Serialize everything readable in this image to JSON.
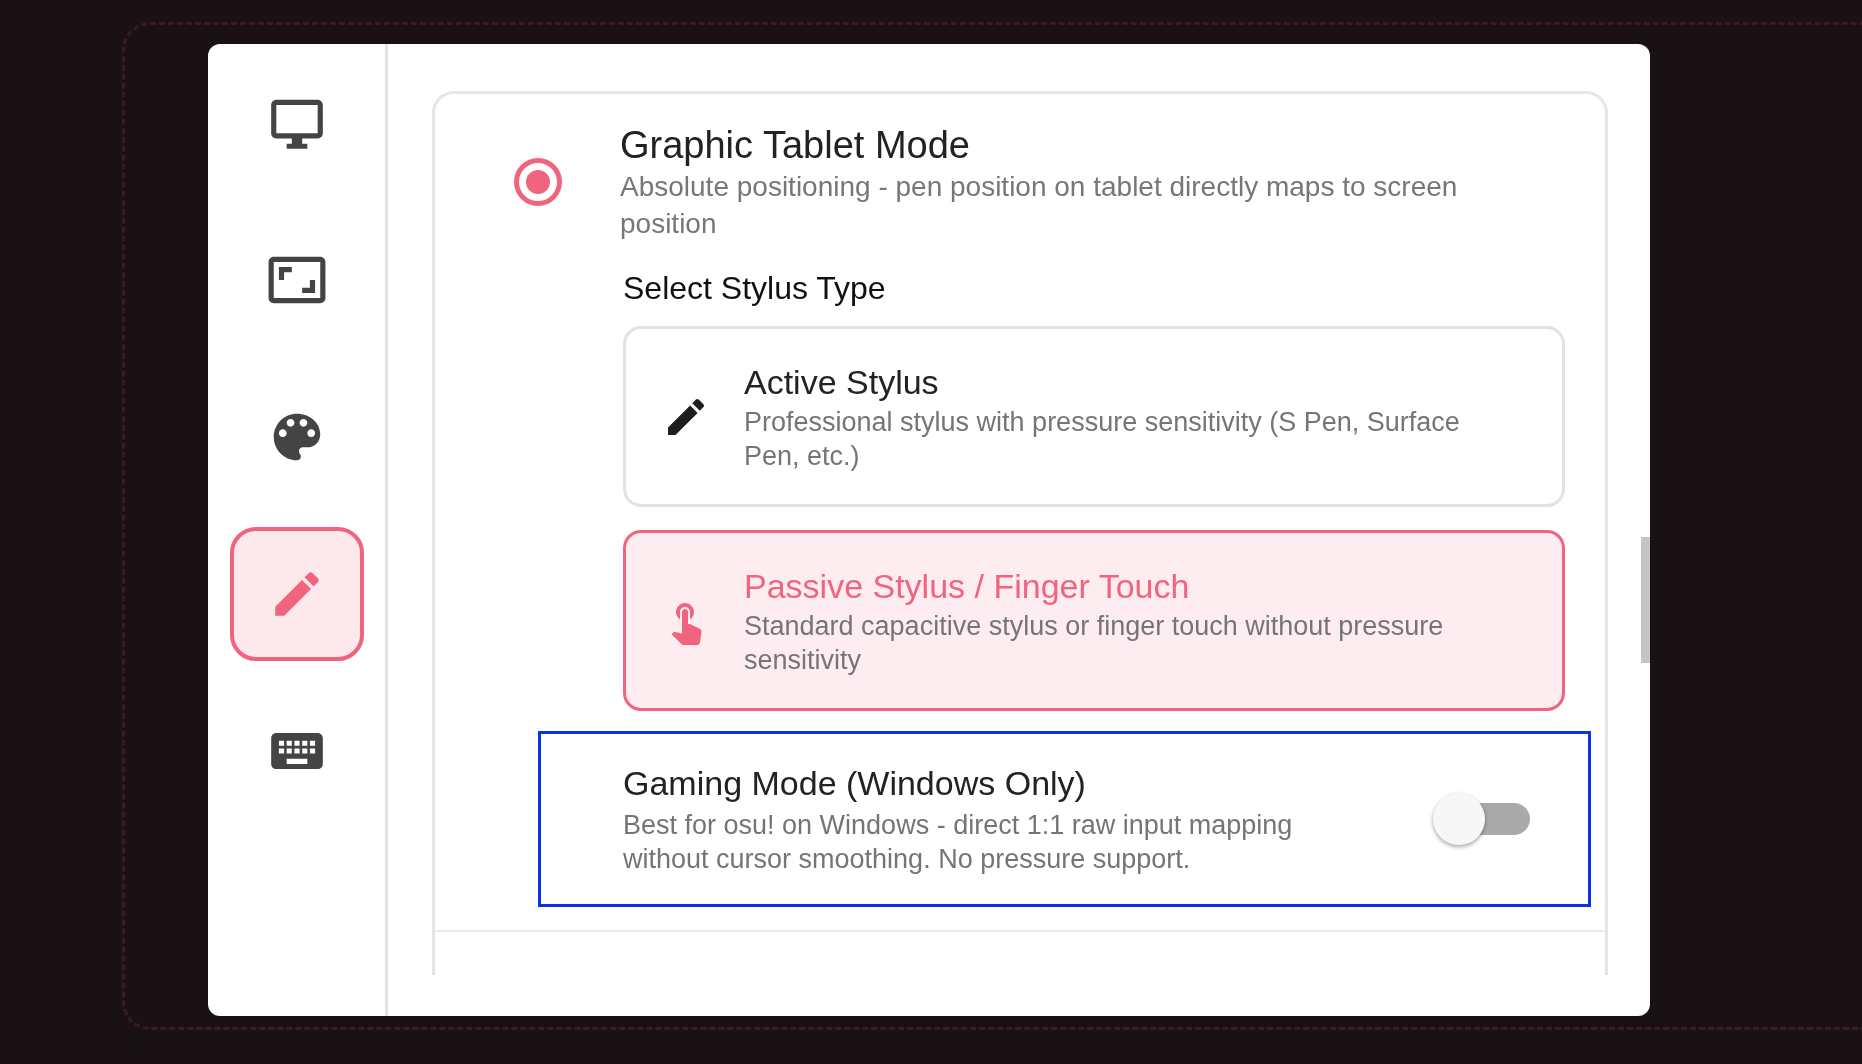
{
  "sidebar": {
    "items": [
      {
        "kind": "monitor",
        "selected": false
      },
      {
        "kind": "frame",
        "selected": false
      },
      {
        "kind": "palette",
        "selected": false
      },
      {
        "kind": "pen",
        "selected": true
      },
      {
        "kind": "keyboard",
        "selected": false
      }
    ]
  },
  "mode": {
    "title": "Graphic Tablet Mode",
    "description": "Absolute positioning - pen position on tablet directly maps to screen position",
    "selected": true
  },
  "stylus": {
    "heading": "Select Stylus Type",
    "options": [
      {
        "kind": "pen",
        "title": "Active Stylus",
        "description": "Professional stylus with pressure sensitivity (S Pen, Surface Pen, etc.)",
        "selected": false
      },
      {
        "kind": "touch",
        "title": "Passive Stylus / Finger Touch",
        "description": "Standard capacitive stylus or finger touch without pressure sensitivity",
        "selected": true
      }
    ]
  },
  "gaming_mode": {
    "title": "Gaming Mode (Windows Only)",
    "description": "Best for osu! on Windows - direct 1:1 raw input mapping without cursor smoothing. No pressure support.",
    "on": false,
    "focused": true
  }
}
